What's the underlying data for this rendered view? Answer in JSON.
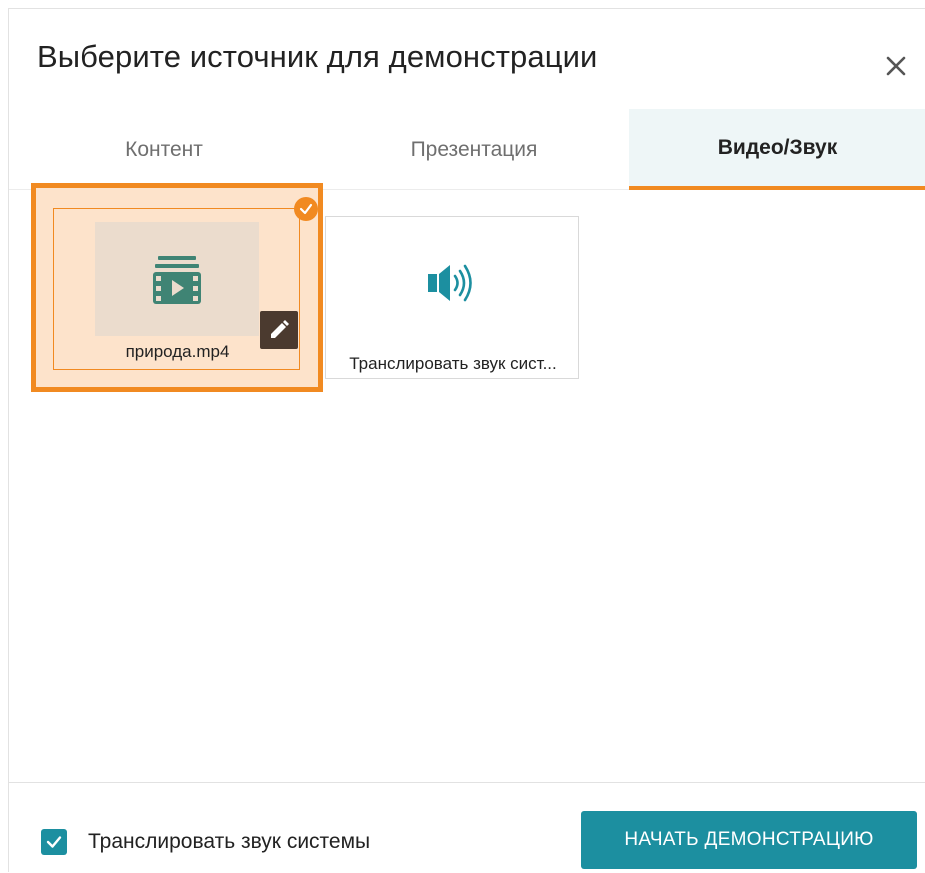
{
  "dialog": {
    "title": "Выберите источник для демонстрации",
    "close_icon": "close-icon"
  },
  "tabs": [
    {
      "label": "Контент",
      "active": false
    },
    {
      "label": "Презентация",
      "active": false
    },
    {
      "label": "Видео/Звук",
      "active": true
    }
  ],
  "sources": [
    {
      "label": "природа.mp4",
      "icon": "video-file-icon",
      "selected": true,
      "edit_icon": "pencil-icon"
    },
    {
      "label": "Транслировать звук системы",
      "label_display": "Транслировать звук сист...",
      "icon": "speaker-icon",
      "selected": false
    }
  ],
  "footer": {
    "checkbox_label": "Транслировать звук системы",
    "checkbox_checked": true,
    "start_button": "НАЧАТЬ ДЕМОНСТРАЦИЮ"
  },
  "colors": {
    "accent_orange": "#f18a21",
    "primary_teal": "#1c8fa0",
    "selected_bg": "#fde3cb",
    "active_tab_bg": "#eef6f7"
  }
}
